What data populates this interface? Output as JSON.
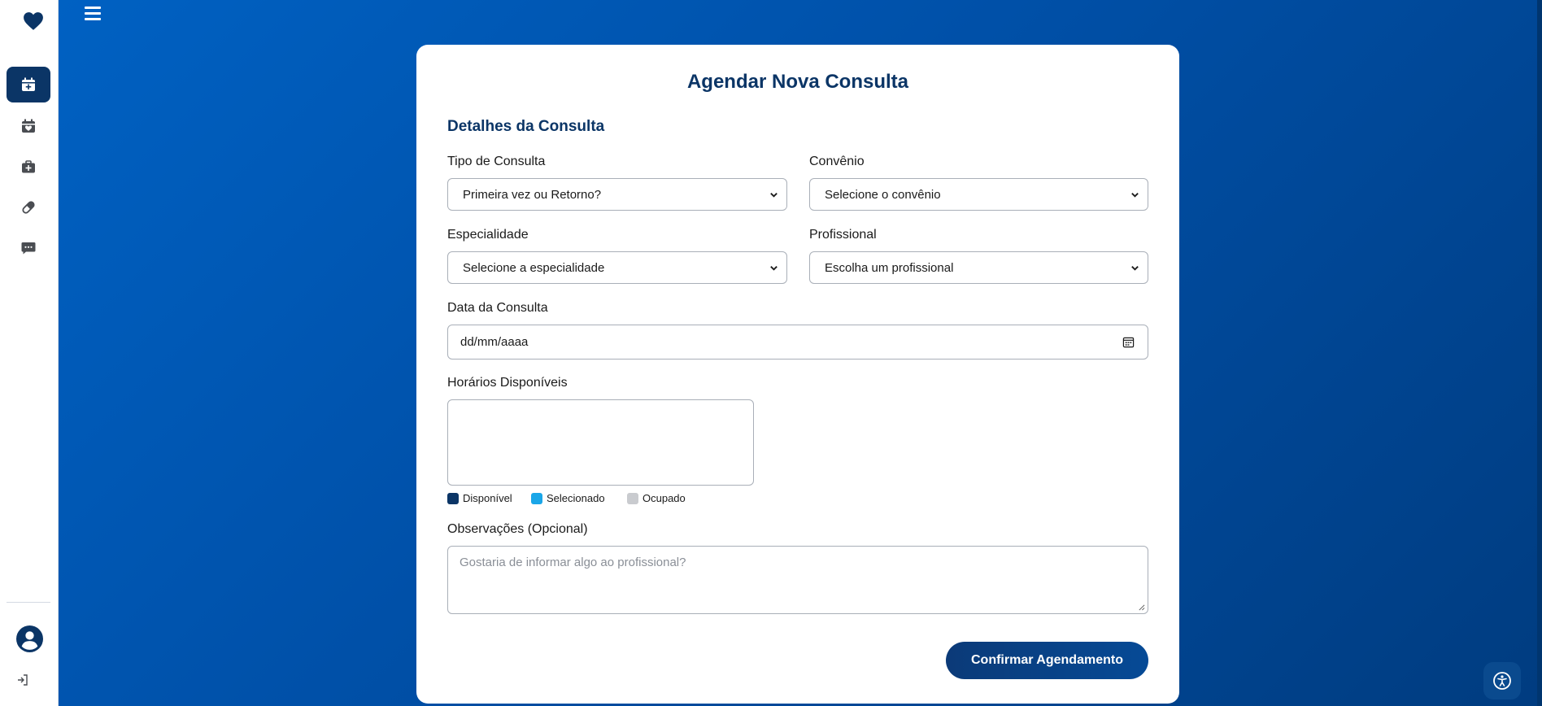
{
  "colors": {
    "primary": "#0b3566",
    "available": "#0b3566",
    "selected": "#1aa6e8",
    "occupied": "#c9cbcf"
  },
  "sidebar": {
    "items": [
      {
        "icon": "calendar-plus-icon",
        "active": true
      },
      {
        "icon": "calendar-heart-icon",
        "active": false
      },
      {
        "icon": "medical-kit-icon",
        "active": false
      },
      {
        "icon": "pill-icon",
        "active": false
      },
      {
        "icon": "chat-message-icon",
        "active": false
      }
    ],
    "bottom": [
      "user-avatar-icon",
      "logout-icon"
    ]
  },
  "form": {
    "title": "Agendar Nova Consulta",
    "section_title": "Detalhes da Consulta",
    "tipo": {
      "label": "Tipo de Consulta",
      "value": "Primeira vez ou Retorno?"
    },
    "convenio": {
      "label": "Convênio",
      "value": "Selecione o convênio"
    },
    "especialidade": {
      "label": "Especialidade",
      "value": "Selecione a especialidade"
    },
    "profissional": {
      "label": "Profissional",
      "value": "Escolha um profissional"
    },
    "data": {
      "label": "Data da Consulta",
      "placeholder": "dd/mm/aaaa"
    },
    "horarios": {
      "label": "Horários Disponíveis"
    },
    "legend": {
      "available": "Disponível",
      "selected": "Selecionado",
      "occupied": "Ocupado"
    },
    "observacoes": {
      "label": "Observações (Opcional)",
      "placeholder": "Gostaria de informar algo ao profissional?"
    },
    "confirm_label": "Confirmar Agendamento"
  }
}
